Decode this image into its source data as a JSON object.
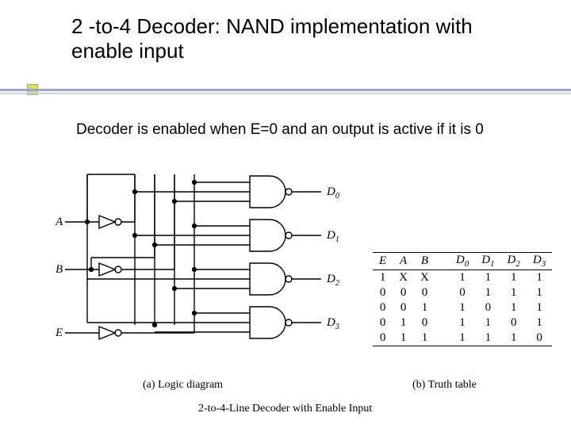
{
  "title": "2 -to-4 Decoder: NAND implementation with enable input",
  "body": "Decoder is enabled when E=0 and an output is active if it is 0",
  "inputs": {
    "a": "A",
    "b": "B",
    "e": "E"
  },
  "outputs": {
    "d0": "D",
    "d0s": "0",
    "d1": "D",
    "d1s": "1",
    "d2": "D",
    "d2s": "2",
    "d3": "D",
    "d3s": "3"
  },
  "captions": {
    "a": "(a) Logic diagram",
    "b": "(b) Truth table",
    "main": "2-to-4-Line Decoder with Enable Input"
  },
  "tt_header": [
    "E",
    "A",
    "B",
    "",
    "D",
    "0",
    "D",
    "1",
    "D",
    "2",
    "D",
    "3"
  ],
  "tt_rows": [
    [
      "1",
      "X",
      "X",
      "",
      "1",
      "1",
      "1",
      "1"
    ],
    [
      "0",
      "0",
      "0",
      "",
      "0",
      "1",
      "1",
      "1"
    ],
    [
      "0",
      "0",
      "1",
      "",
      "1",
      "0",
      "1",
      "1"
    ],
    [
      "0",
      "1",
      "0",
      "",
      "1",
      "1",
      "0",
      "1"
    ],
    [
      "0",
      "1",
      "1",
      "",
      "1",
      "1",
      "1",
      "0"
    ]
  ],
  "chart_data": {
    "type": "table",
    "title": "2-to-4 decoder with active-low enable, NAND outputs (active-low)",
    "columns": [
      "E",
      "A",
      "B",
      "D0",
      "D1",
      "D2",
      "D3"
    ],
    "rows": [
      {
        "E": 1,
        "A": "X",
        "B": "X",
        "D0": 1,
        "D1": 1,
        "D2": 1,
        "D3": 1
      },
      {
        "E": 0,
        "A": 0,
        "B": 0,
        "D0": 0,
        "D1": 1,
        "D2": 1,
        "D3": 1
      },
      {
        "E": 0,
        "A": 0,
        "B": 1,
        "D0": 1,
        "D1": 0,
        "D2": 1,
        "D3": 1
      },
      {
        "E": 0,
        "A": 1,
        "B": 0,
        "D0": 1,
        "D1": 1,
        "D2": 0,
        "D3": 1
      },
      {
        "E": 0,
        "A": 1,
        "B": 1,
        "D0": 1,
        "D1": 1,
        "D2": 1,
        "D3": 0
      }
    ]
  }
}
